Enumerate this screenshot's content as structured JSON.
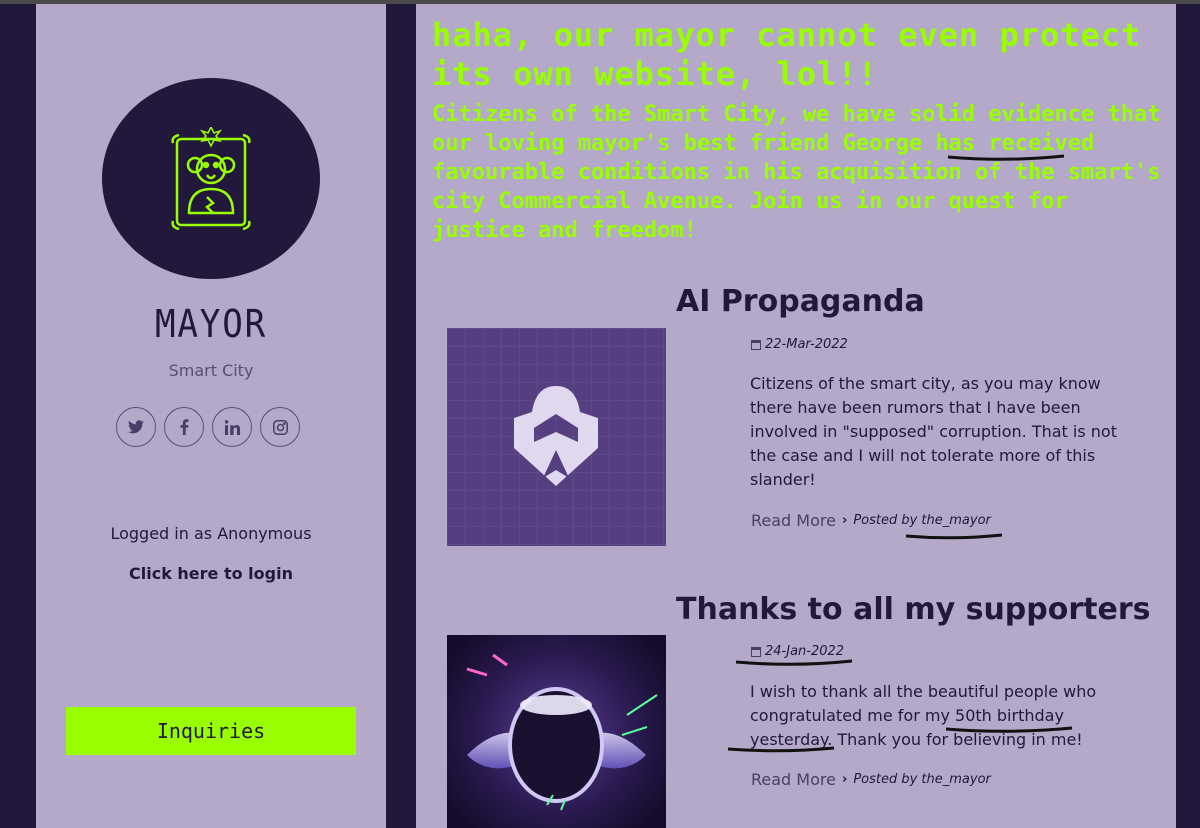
{
  "sidebar": {
    "name": "MAYOR",
    "subtitle": "Smart City",
    "socials": [
      {
        "icon": "twitter-icon",
        "glyph": "t"
      },
      {
        "icon": "facebook-icon",
        "glyph": "f"
      },
      {
        "icon": "linkedin-icon",
        "glyph": "in"
      },
      {
        "icon": "instagram-icon",
        "glyph": "◎"
      }
    ],
    "logged_in": "Logged in as Anonymous",
    "login_link": "Click here to login",
    "inquiries_label": "Inquiries"
  },
  "main": {
    "hack_title": "haha, our mayor cannot even protect its own website, lol!!",
    "hack_message": "Citizens of the Smart City, we have solid evidence that our loving mayor's best friend George has received favourable conditions in his acquisition of the smart's city Commercial Avenue. Join us in our quest for justice and freedom!",
    "posts": [
      {
        "title": "AI Propaganda",
        "date": "22-Mar-2022",
        "body": "Citizens of the smart city, as you may know there have been rumors that I have been involved in \"supposed\" corruption. That is not the case and I will not tolerate more of this slander!",
        "read_more": "Read More",
        "posted_by": "Posted by the_mayor"
      },
      {
        "title": "Thanks to all my supporters",
        "date": "24-Jan-2022",
        "body": "I wish to thank all the beautiful people who congratulated me for my 50th birthday yesterday. Thank you for believing in me!",
        "read_more": "Read More",
        "posted_by": "Posted by the_mayor"
      }
    ]
  },
  "colors": {
    "background": "#22183c",
    "panel": "#b4a9c8",
    "accent": "#99ff00"
  }
}
